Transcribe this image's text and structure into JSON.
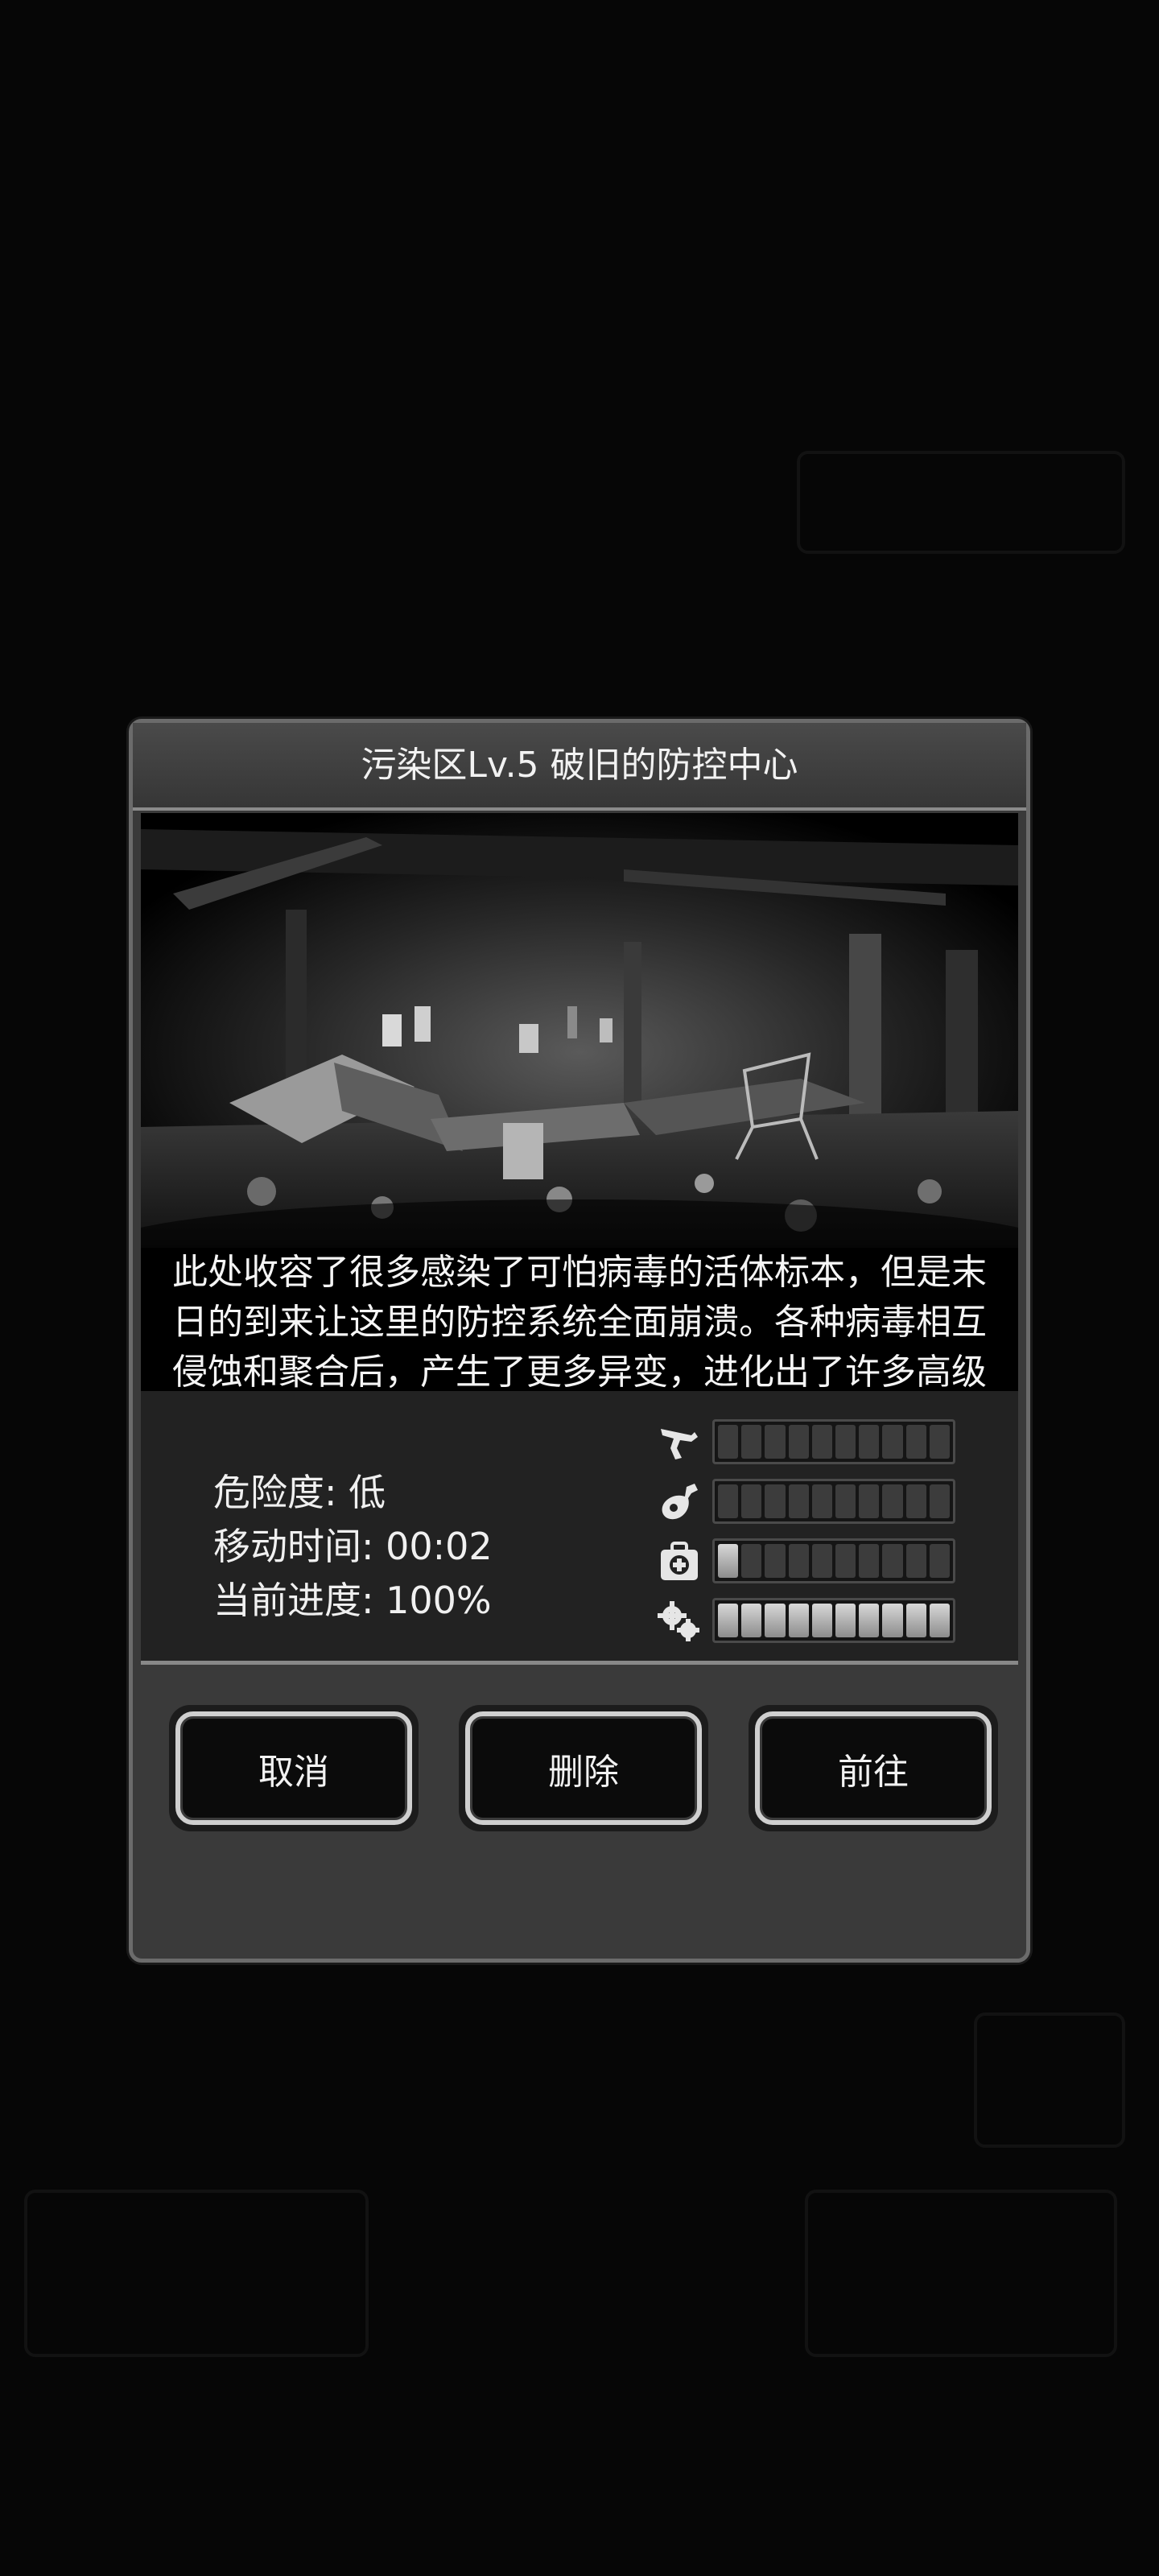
{
  "dialog": {
    "title": "污染区Lv.5 破旧的防控中心",
    "description": "此处收容了很多感染了可怕病毒的活体标本，但是末日的到来让这里的防控系统全面崩溃。各种病毒相互侵蚀和聚合后，产生了更多异变，进化出了许多高级丧尸。",
    "stats": {
      "danger": "危险度: 低",
      "move_time": "移动时间: 00:02",
      "progress": "当前进度: 100%"
    },
    "resources": [
      {
        "icon": "gun-icon",
        "filled": 0,
        "total": 10
      },
      {
        "icon": "meat-icon",
        "filled": 0,
        "total": 10
      },
      {
        "icon": "medkit-icon",
        "filled": 1,
        "total": 10
      },
      {
        "icon": "gears-icon",
        "filled": 10,
        "total": 10
      }
    ],
    "buttons": {
      "cancel": "取消",
      "delete": "删除",
      "go": "前往"
    }
  },
  "colors": {
    "backdrop": "#060606",
    "panel": "#3a3a3a",
    "panel_border": "#6b6b6b",
    "text": "#f2f2f2"
  }
}
